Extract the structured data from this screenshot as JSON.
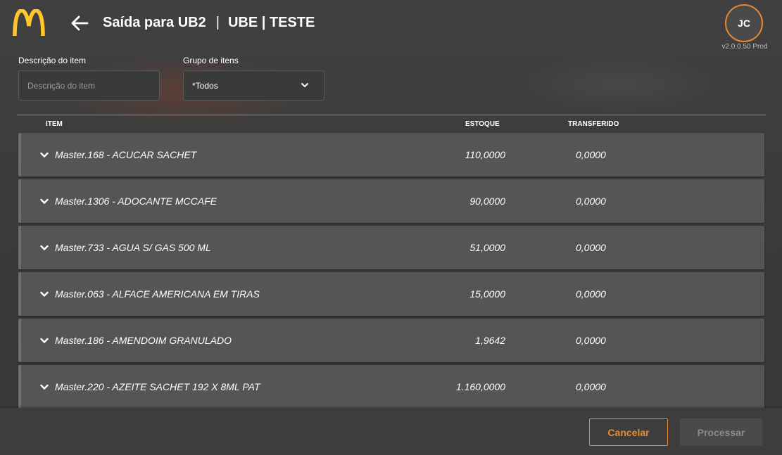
{
  "header": {
    "title": "Saída para UB2",
    "separator": "|",
    "store": "UBE | TESTE",
    "avatar_initials": "JC",
    "version": "v2.0.0.50 Prod"
  },
  "filters": {
    "description_label": "Descrição do item",
    "description_placeholder": "Descrição do item",
    "group_label": "Grupo de itens",
    "group_selected": "*Todos"
  },
  "table": {
    "columns": {
      "item": "ITEM",
      "stock": "ESTOQUE",
      "transferred": "TRANSFERIDO"
    },
    "rows": [
      {
        "name": "Master.168 - ACUCAR SACHET",
        "stock": "110,0000",
        "transferred": "0,0000"
      },
      {
        "name": "Master.1306 - ADOCANTE MCCAFE",
        "stock": "90,0000",
        "transferred": "0,0000"
      },
      {
        "name": "Master.733 - AGUA S/ GAS 500 ML",
        "stock": "51,0000",
        "transferred": "0,0000"
      },
      {
        "name": "Master.063 - ALFACE AMERICANA EM TIRAS",
        "stock": "15,0000",
        "transferred": "0,0000"
      },
      {
        "name": "Master.186 - AMENDOIM GRANULADO",
        "stock": "1,9642",
        "transferred": "0,0000"
      },
      {
        "name": "Master.220 - AZEITE SACHET 192 X 8ML PAT",
        "stock": "1.160,0000",
        "transferred": "0,0000"
      }
    ]
  },
  "footer": {
    "cancel_label": "Cancelar",
    "process_label": "Processar"
  },
  "colors": {
    "accent": "#e8892f",
    "logo": "#ffc72c"
  },
  "icons": {
    "logo": "mcdonalds-logo",
    "back": "arrow-left-icon",
    "dropdown": "chevron-down-icon",
    "expand": "chevron-down-icon"
  }
}
